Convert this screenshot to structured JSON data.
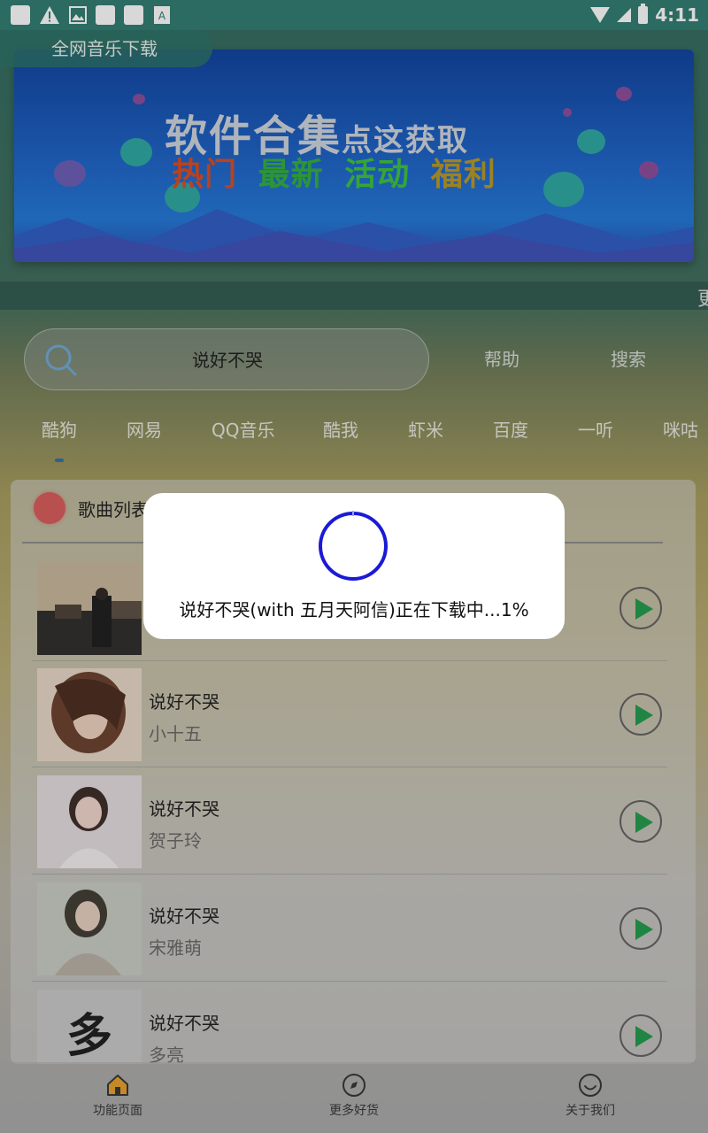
{
  "status_bar": {
    "time": "4:11"
  },
  "app": {
    "title": "全网音乐下载"
  },
  "banner": {
    "main_text": "软件合集",
    "main_suffix": "点这获取",
    "tags": [
      {
        "text": "热门",
        "color": "#d9481e"
      },
      {
        "text": "最新",
        "color": "#2fae3a"
      },
      {
        "text": "活动",
        "color": "#39c23a"
      },
      {
        "text": "福利",
        "color": "#b79722"
      }
    ]
  },
  "marquee": {
    "text": "更"
  },
  "search": {
    "query": "说好不哭",
    "help_label": "帮助",
    "search_label": "搜索"
  },
  "sources": [
    "酷狗",
    "网易",
    "QQ音乐",
    "酷我",
    "虾米",
    "百度",
    "一听",
    "咪咕"
  ],
  "list": {
    "title": "歌曲列表",
    "songs": [
      {
        "title": "",
        "artist": ""
      },
      {
        "title": "说好不哭",
        "artist": "小十五"
      },
      {
        "title": "说好不哭",
        "artist": "贺子玲"
      },
      {
        "title": "说好不哭",
        "artist": "宋雅萌"
      },
      {
        "title": "说好不哭",
        "artist": "多亮"
      }
    ]
  },
  "nav": [
    {
      "label": "功能页面",
      "icon": "home-icon"
    },
    {
      "label": "更多好货",
      "icon": "compass-icon"
    },
    {
      "label": "关于我们",
      "icon": "smile-icon"
    }
  ],
  "dialog": {
    "message": "说好不哭(with 五月天阿信)正在下载中...1%",
    "progress_percent": 1,
    "spinner_color": "#1a1ad6"
  }
}
